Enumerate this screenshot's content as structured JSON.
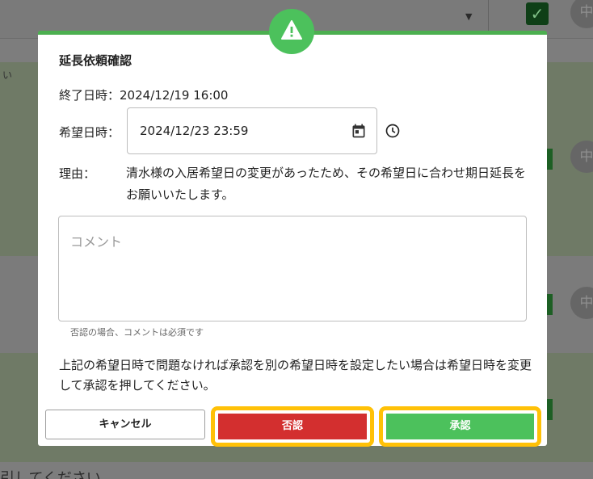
{
  "background": {
    "avatar_char": "中",
    "left_fragment": "い",
    "bottom_text": "引してください"
  },
  "modal": {
    "title": "延長依頼確認",
    "end_datetime_label": "終了日時：",
    "end_datetime_value": "2024/12/19 16:00",
    "hope_datetime_label": "希望日時：",
    "hope_datetime_value": "2024/12/23 23:59",
    "reason_label": "理由：",
    "reason_text": "清水様の入居希望日の変更があったため、その希望日に合わせ期日延長をお願いいたします。",
    "comment_placeholder": "コメント",
    "comment_hint": "否認の場合、コメントは必須です",
    "notice": "上記の希望日時で問題なければ承認を別の希望日時を設定したい場合は希望日時を変更して承認を押してください。",
    "buttons": {
      "cancel": "キャンセル",
      "reject": "否認",
      "approve": "承認"
    }
  },
  "colors": {
    "accent_green": "#4cc15c",
    "reject_red": "#d32f2f",
    "highlight": "#ffc107"
  },
  "icons": {
    "badge": "warning-icon",
    "date": "calendar-icon",
    "time": "clock-icon"
  }
}
